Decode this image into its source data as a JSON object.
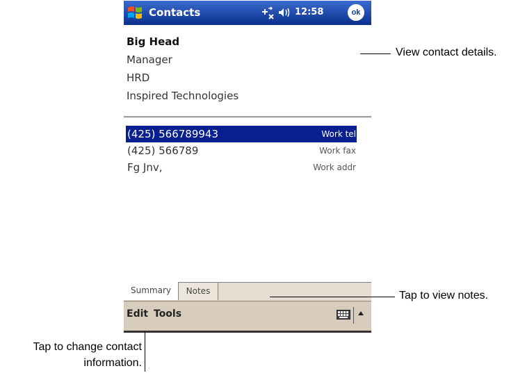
{
  "titlebar": {
    "title": "Contacts",
    "clock": "12:58",
    "ok_label": "ok",
    "start_icon": "windows-flag-icon",
    "connection_icon": "connectivity-icon",
    "volume_icon": "speaker-icon"
  },
  "contact": {
    "name": "Big Head",
    "title": "Manager",
    "department": "HRD",
    "company": "Inspired Technologies"
  },
  "entries": [
    {
      "value": "(425) 566789943",
      "type": "Work tel",
      "selected": true
    },
    {
      "value": "(425) 566789",
      "type": "Work fax",
      "selected": false
    },
    {
      "value": "Fg Jnv,",
      "type": "Work addr",
      "selected": false
    }
  ],
  "tabs": [
    {
      "label": "Summary",
      "active": true
    },
    {
      "label": "Notes",
      "active": false
    }
  ],
  "menubar": {
    "edit_label": "Edit",
    "tools_label": "Tools",
    "keyboard_icon": "keyboard-icon"
  },
  "callouts": {
    "details": "View contact details.",
    "notes": "Tap to view notes.",
    "edit_line1": "Tap to change contact",
    "edit_line2": "information."
  },
  "colors": {
    "titlebar": "#0c3c9c",
    "selection": "#0a1f8f",
    "menubar": "#d8cdbd"
  }
}
